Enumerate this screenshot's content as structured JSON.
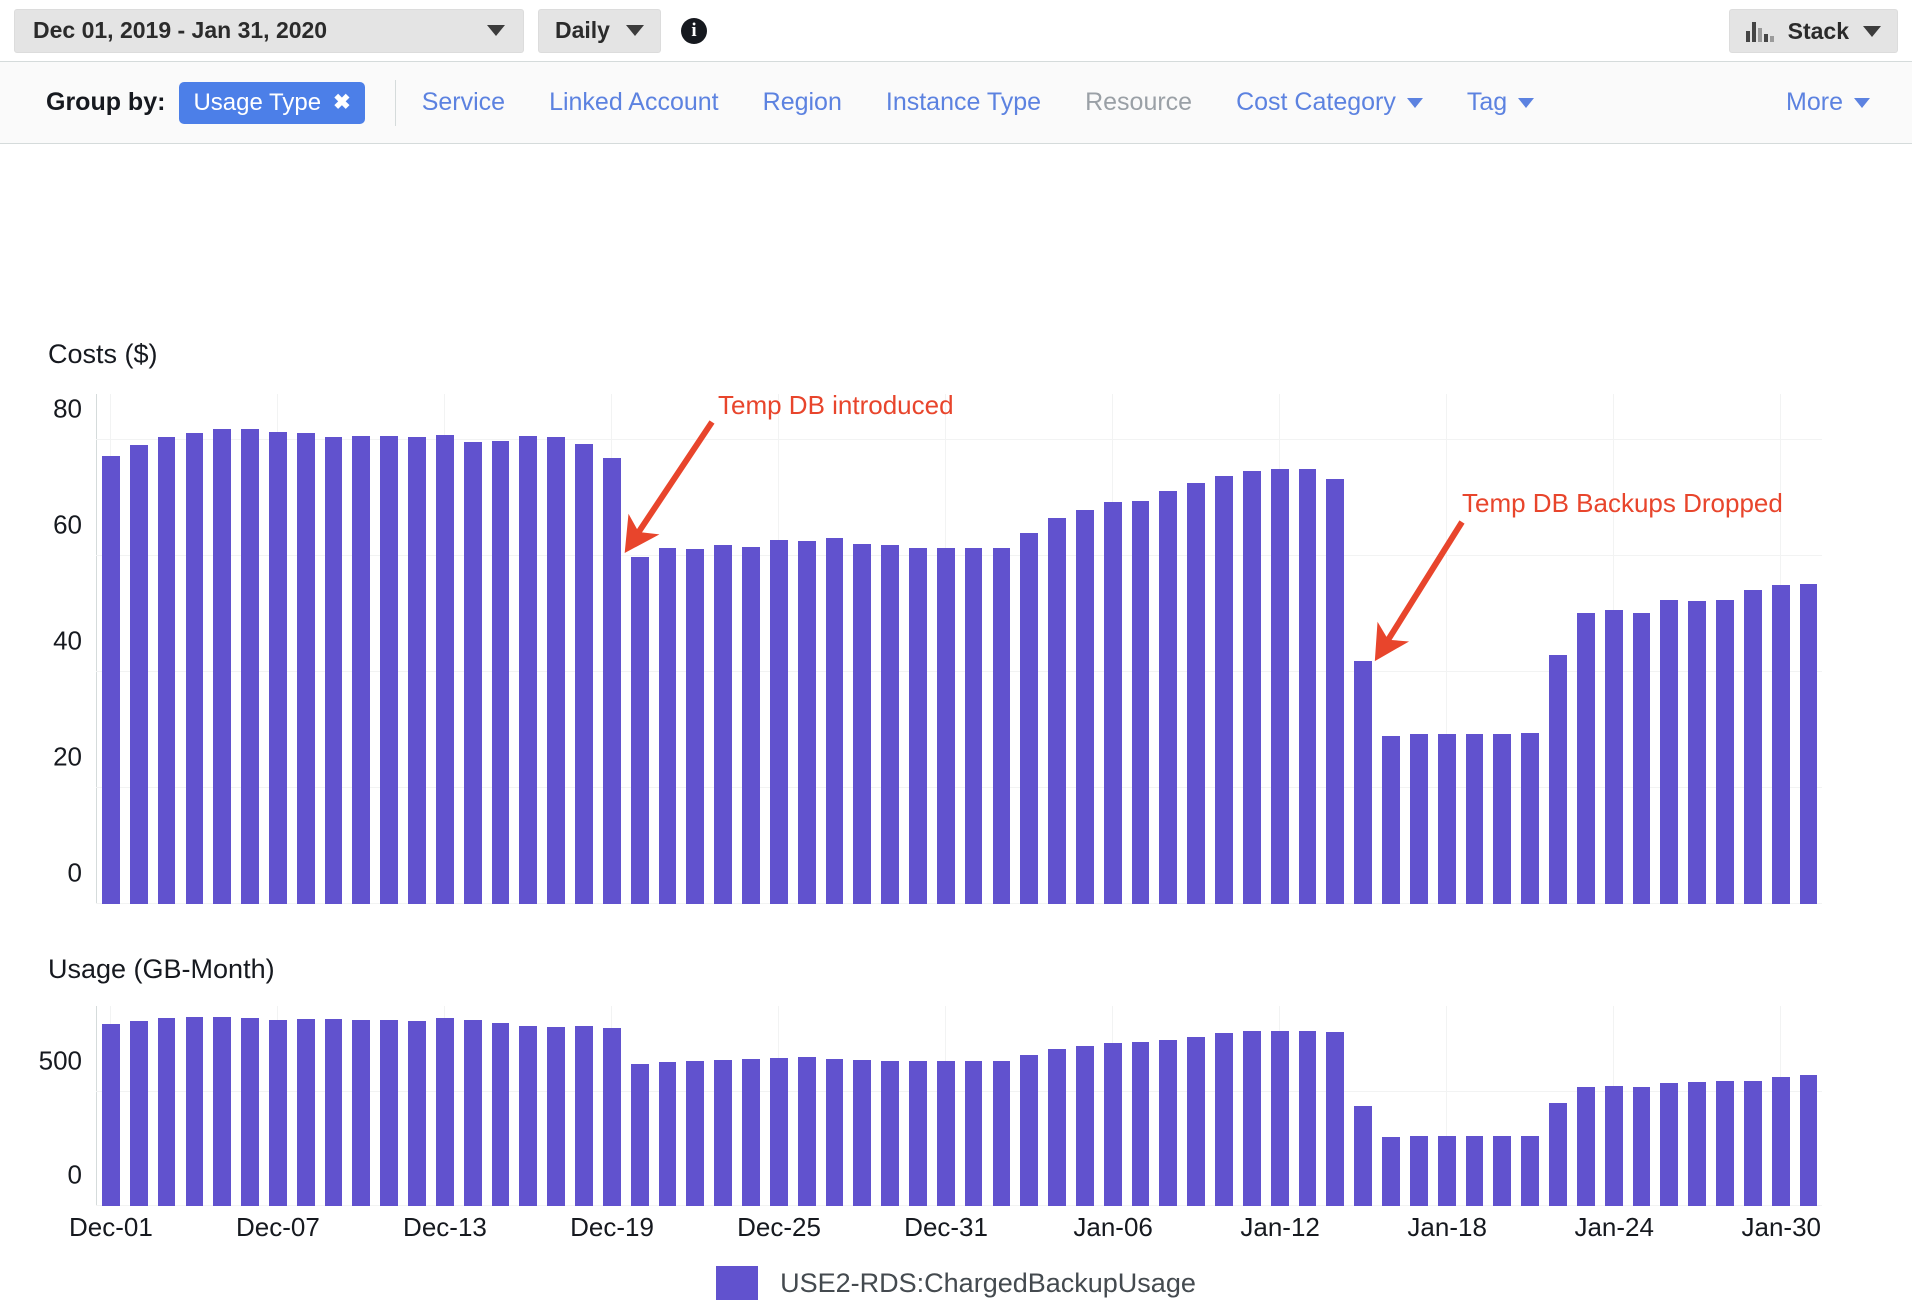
{
  "toolbar": {
    "date_range": "Dec 01, 2019 - Jan 31, 2020",
    "granularity": "Daily",
    "info_icon": "info-icon",
    "stack_label": "Stack",
    "stack_icon": "bar-chart-icon"
  },
  "group_by": {
    "label": "Group by:",
    "active_pill": {
      "label": "Usage Type",
      "remove_icon": "close-icon"
    },
    "options": [
      {
        "label": "Service",
        "disabled": false,
        "dropdown": false
      },
      {
        "label": "Linked Account",
        "disabled": false,
        "dropdown": false
      },
      {
        "label": "Region",
        "disabled": false,
        "dropdown": false
      },
      {
        "label": "Instance Type",
        "disabled": false,
        "dropdown": false
      },
      {
        "label": "Resource",
        "disabled": true,
        "dropdown": false
      },
      {
        "label": "Cost Category",
        "disabled": false,
        "dropdown": true
      },
      {
        "label": "Tag",
        "disabled": false,
        "dropdown": true
      }
    ],
    "more": {
      "label": "More",
      "dropdown": true
    }
  },
  "colors": {
    "bar": "#6152ce",
    "annotation": "#e8452c",
    "link": "#5c82e0",
    "pill": "#4c7fe8",
    "grid": "#f2f3f3"
  },
  "legend": [
    {
      "label": "USE2-RDS:ChargedBackupUsage",
      "color": "#6152ce"
    }
  ],
  "annotations": [
    {
      "text": "Temp DB introduced",
      "target_index": 18
    },
    {
      "text": "Temp DB Backups Dropped",
      "target_index": 45
    }
  ],
  "chart_data": [
    {
      "type": "bar",
      "title": "Costs ($)",
      "ylabel": "Costs ($)",
      "xlabel": "",
      "ylim": [
        0,
        88
      ],
      "yticks": [
        0,
        20,
        40,
        60,
        80
      ],
      "grid": true,
      "legend_position": "bottom",
      "categories": [
        "Dec-01",
        "Dec-02",
        "Dec-03",
        "Dec-04",
        "Dec-05",
        "Dec-06",
        "Dec-07",
        "Dec-08",
        "Dec-09",
        "Dec-10",
        "Dec-11",
        "Dec-12",
        "Dec-13",
        "Dec-14",
        "Dec-15",
        "Dec-16",
        "Dec-17",
        "Dec-18",
        "Dec-19",
        "Dec-20",
        "Dec-21",
        "Dec-22",
        "Dec-23",
        "Dec-24",
        "Dec-25",
        "Dec-26",
        "Dec-27",
        "Dec-28",
        "Dec-29",
        "Dec-30",
        "Dec-31",
        "Jan-01",
        "Jan-02",
        "Jan-03",
        "Jan-04",
        "Jan-05",
        "Jan-06",
        "Jan-07",
        "Jan-08",
        "Jan-09",
        "Jan-10",
        "Jan-11",
        "Jan-12",
        "Jan-13",
        "Jan-14",
        "Jan-15",
        "Jan-16",
        "Jan-17",
        "Jan-18",
        "Jan-19",
        "Jan-20",
        "Jan-21",
        "Jan-22",
        "Jan-23",
        "Jan-24",
        "Jan-25",
        "Jan-26",
        "Jan-27",
        "Jan-28",
        "Jan-29",
        "Jan-30",
        "Jan-31"
      ],
      "series": [
        {
          "name": "USE2-RDS:ChargedBackupUsage",
          "color": "#6152ce",
          "values": [
            77.3,
            79.2,
            80.5,
            81.2,
            82.0,
            81.9,
            81.5,
            81.2,
            80.6,
            80.8,
            80.7,
            80.6,
            81.0,
            79.8,
            79.9,
            80.8,
            80.6,
            79.3,
            77.0,
            59.8,
            61.4,
            61.3,
            61.9,
            61.6,
            62.8,
            62.6,
            63.2,
            62.2,
            61.9,
            61.5,
            61.4,
            61.5,
            61.4,
            64.0,
            66.6,
            68.0,
            69.3,
            69.6,
            71.2,
            72.6,
            73.8,
            74.8,
            75.0,
            75.1,
            73.4,
            42.0,
            29.0,
            29.4,
            29.3,
            29.4,
            29.3,
            29.5,
            42.9,
            50.2,
            50.7,
            50.2,
            52.4,
            52.3,
            52.5,
            54.2,
            55.0,
            55.3
          ]
        }
      ]
    },
    {
      "type": "bar",
      "title": "Usage (GB-Month)",
      "ylabel": "Usage (GB-Month)",
      "xlabel": "",
      "ylim": [
        0,
        880
      ],
      "yticks": [
        0,
        500
      ],
      "grid": true,
      "legend_position": "bottom",
      "categories": [
        "Dec-01",
        "Dec-02",
        "Dec-03",
        "Dec-04",
        "Dec-05",
        "Dec-06",
        "Dec-07",
        "Dec-08",
        "Dec-09",
        "Dec-10",
        "Dec-11",
        "Dec-12",
        "Dec-13",
        "Dec-14",
        "Dec-15",
        "Dec-16",
        "Dec-17",
        "Dec-18",
        "Dec-19",
        "Dec-20",
        "Dec-21",
        "Dec-22",
        "Dec-23",
        "Dec-24",
        "Dec-25",
        "Dec-26",
        "Dec-27",
        "Dec-28",
        "Dec-29",
        "Dec-30",
        "Dec-31",
        "Jan-01",
        "Jan-02",
        "Jan-03",
        "Jan-04",
        "Jan-05",
        "Jan-06",
        "Jan-07",
        "Jan-08",
        "Jan-09",
        "Jan-10",
        "Jan-11",
        "Jan-12",
        "Jan-13",
        "Jan-14",
        "Jan-15",
        "Jan-16",
        "Jan-17",
        "Jan-18",
        "Jan-19",
        "Jan-20",
        "Jan-21",
        "Jan-22",
        "Jan-23",
        "Jan-24",
        "Jan-25",
        "Jan-26",
        "Jan-27",
        "Jan-28",
        "Jan-29",
        "Jan-30",
        "Jan-31"
      ],
      "series": [
        {
          "name": "USE2-RDS:ChargedBackupUsage",
          "color": "#6152ce",
          "values": [
            800,
            812,
            828,
            833,
            832,
            828,
            820,
            822,
            821,
            820,
            818,
            816,
            828,
            820,
            805,
            790,
            788,
            790,
            782,
            627,
            635,
            640,
            643,
            645,
            652,
            655,
            648,
            642,
            640,
            638,
            638,
            640,
            638,
            665,
            690,
            705,
            718,
            722,
            730,
            742,
            760,
            772,
            772,
            770,
            765,
            440,
            305,
            308,
            306,
            310,
            308,
            310,
            455,
            522,
            528,
            522,
            540,
            545,
            548,
            552,
            568,
            575
          ]
        }
      ]
    }
  ],
  "xaxis_ticks": [
    {
      "label": "Dec-01",
      "index": 0
    },
    {
      "label": "Dec-07",
      "index": 6
    },
    {
      "label": "Dec-13",
      "index": 12
    },
    {
      "label": "Dec-19",
      "index": 18
    },
    {
      "label": "Dec-25",
      "index": 24
    },
    {
      "label": "Dec-31",
      "index": 30
    },
    {
      "label": "Jan-06",
      "index": 36
    },
    {
      "label": "Jan-12",
      "index": 42
    },
    {
      "label": "Jan-18",
      "index": 48
    },
    {
      "label": "Jan-24",
      "index": 54
    },
    {
      "label": "Jan-30",
      "index": 60
    }
  ]
}
